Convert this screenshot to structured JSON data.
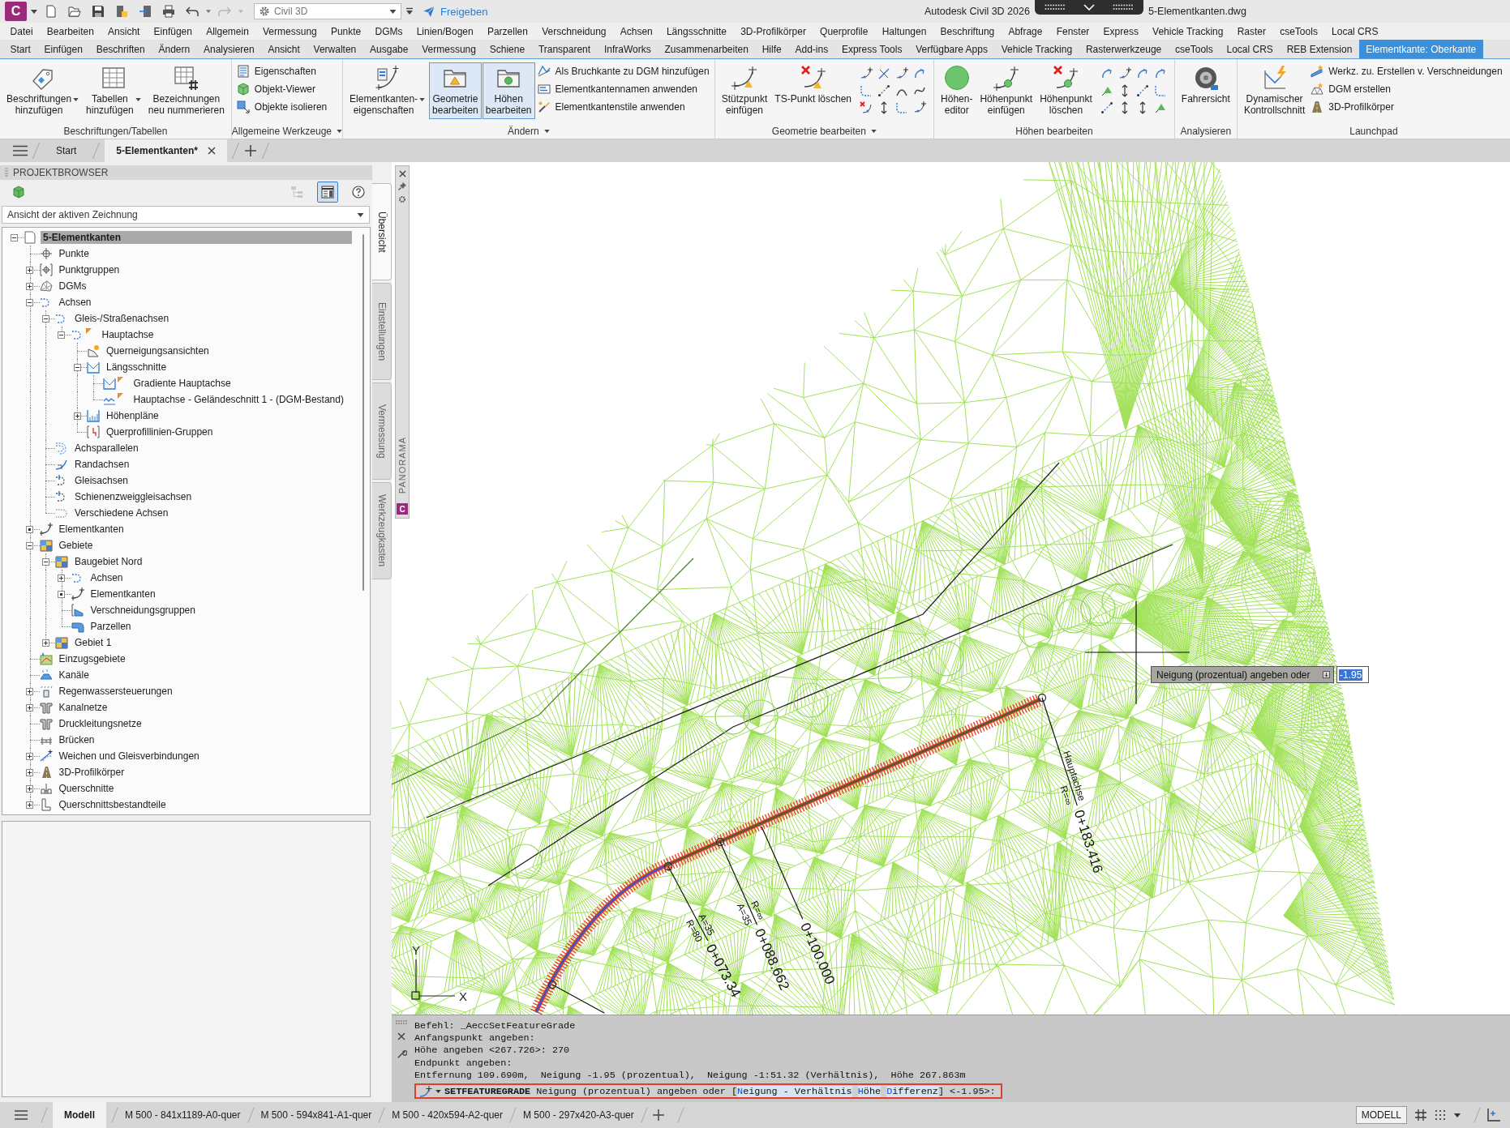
{
  "title_bar": {
    "logo": "C",
    "workspace": "Civil 3D",
    "share": "Freigeben",
    "title": "Autodesk Civil 3D 2026",
    "file": "5-Elementkanten.dwg"
  },
  "menu_bar": [
    "Datei",
    "Bearbeiten",
    "Ansicht",
    "Einfügen",
    "Allgemein",
    "Vermessung",
    "Punkte",
    "DGMs",
    "Linien/Bogen",
    "Parzellen",
    "Verschneidung",
    "Achsen",
    "Längsschnitte",
    "3D-Profilkörper",
    "Querprofile",
    "Haltungen",
    "Beschriftung",
    "Abfrage",
    "Fenster",
    "Express",
    "Vehicle Tracking",
    "Raster",
    "cseTools",
    "Local CRS"
  ],
  "ribbon": {
    "tabs": [
      {
        "label": "Start",
        "selected": false
      },
      {
        "label": "Einfügen",
        "selected": false
      },
      {
        "label": "Beschriften",
        "selected": false
      },
      {
        "label": "Ändern",
        "selected": false
      },
      {
        "label": "Analysieren",
        "selected": false
      },
      {
        "label": "Ansicht",
        "selected": false
      },
      {
        "label": "Verwalten",
        "selected": false
      },
      {
        "label": "Ausgabe",
        "selected": false
      },
      {
        "label": "Vermessung",
        "selected": false
      },
      {
        "label": "Schiene",
        "selected": false
      },
      {
        "label": "Transparent",
        "selected": false
      },
      {
        "label": "InfraWorks",
        "selected": false
      },
      {
        "label": "Zusammenarbeiten",
        "selected": false
      },
      {
        "label": "Hilfe",
        "selected": false
      },
      {
        "label": "Add-ins",
        "selected": false
      },
      {
        "label": "Express Tools",
        "selected": false
      },
      {
        "label": "Verfügbare Apps",
        "selected": false
      },
      {
        "label": "Vehicle Tracking",
        "selected": false
      },
      {
        "label": "Rasterwerkzeuge",
        "selected": false
      },
      {
        "label": "cseTools",
        "selected": false
      },
      {
        "label": "Local CRS",
        "selected": false
      },
      {
        "label": "REB Extension",
        "selected": false
      },
      {
        "label": "Elementkante: Oberkante",
        "selected": true
      }
    ],
    "panels": [
      {
        "title": "Beschriftungen/Tabellen",
        "menu": false,
        "large": [
          {
            "kind": "annotate",
            "label": "Beschriftungen\nhinzufügen",
            "dropdown": true,
            "selected": false
          },
          {
            "kind": "tables",
            "label": "Tabellen\nhinzufügen",
            "dropdown": true,
            "selected": false
          },
          {
            "kind": "renumber",
            "label": "Bezeichnungen\nneu nummerieren",
            "dropdown": false,
            "selected": false
          }
        ]
      },
      {
        "title": "Allgemeine Werkzeuge",
        "menu": true,
        "small": [
          {
            "kind": "properties",
            "label": "Eigenschaften"
          },
          {
            "kind": "viewer",
            "label": "Objekt-Viewer"
          },
          {
            "kind": "isolate",
            "label": "Objekte isolieren"
          }
        ]
      },
      {
        "title": "Ändern",
        "menu": true,
        "large": [
          {
            "kind": "properties",
            "label": "Elementkanten-\neigenschaften",
            "dropdown": true,
            "selected": false
          },
          {
            "kind": "geometry",
            "label": "Geometrie\nbearbeiten",
            "dropdown": false,
            "selected": true
          },
          {
            "kind": "elevations",
            "label": "Höhen\nbearbeiten",
            "dropdown": false,
            "selected": true
          }
        ],
        "small": [
          {
            "kind": "breakline",
            "label": "Als Bruchkante zu DGM hinzufügen"
          },
          {
            "kind": "names",
            "label": "Elementkantennamen anwenden"
          },
          {
            "kind": "styles",
            "label": "Elementkantenstile anwenden"
          }
        ]
      },
      {
        "title": "Geometrie bearbeiten",
        "menu": true,
        "large": [
          {
            "kind": "insert",
            "label": "Stützpunkt\neinfügen",
            "dropdown": false,
            "selected": false
          },
          {
            "kind": "delete",
            "label": "TS-Punkt löschen",
            "dropdown": false,
            "selected": false
          }
        ],
        "grid": [
          {
            "kind": "curvenode"
          },
          {
            "kind": "crossed"
          },
          {
            "kind": "curvenode"
          },
          {
            "kind": "sweep"
          },
          {
            "kind": "corner"
          },
          {
            "kind": "dashed"
          },
          {
            "kind": "arc"
          },
          {
            "kind": "spline"
          },
          {
            "kind": "deletenode"
          },
          {
            "kind": "arrows"
          },
          {
            "kind": "corner"
          },
          {
            "kind": "curvenode"
          }
        ]
      },
      {
        "title": "Höhen bearbeiten",
        "menu": false,
        "large": [
          {
            "kind": "editor",
            "label": "Höhen-\neditor",
            "dropdown": false,
            "selected": false
          },
          {
            "kind": "insertpoint",
            "label": "Höhenpunkt\neinfügen",
            "dropdown": false,
            "selected": false
          },
          {
            "kind": "deletepoint",
            "label": "Höhenpunkt\nlöschen",
            "dropdown": false,
            "selected": false
          }
        ],
        "grid": [
          {
            "kind": "sweep"
          },
          {
            "kind": "curvenode"
          },
          {
            "kind": "sweep"
          },
          {
            "kind": "sweep"
          },
          {
            "kind": "triangle"
          },
          {
            "kind": "arrows"
          },
          {
            "kind": "dashed"
          },
          {
            "kind": "corner"
          },
          {
            "kind": "dashed"
          },
          {
            "kind": "arrows"
          },
          {
            "kind": "arrows"
          },
          {
            "kind": "triangle"
          }
        ]
      },
      {
        "title": "Analysieren",
        "menu": false,
        "large": [
          {
            "kind": "driver",
            "label": "Fahrersicht",
            "dropdown": false,
            "selected": false
          }
        ]
      },
      {
        "title": "Launchpad",
        "menu": false,
        "large": [
          {
            "kind": "section",
            "label": "Dynamischer\nKontrollschnitt",
            "dropdown": false,
            "selected": false
          }
        ],
        "small": [
          {
            "kind": "grading",
            "label": "Werkz. zu. Erstellen v. Verschneidungen"
          },
          {
            "kind": "surface",
            "label": "DGM erstellen"
          },
          {
            "kind": "corridor",
            "label": "3D-Profilkörper"
          }
        ]
      }
    ]
  },
  "document_tabs": [
    {
      "label": "Start",
      "selected": false,
      "closable": false
    },
    {
      "label": "5-Elementkanten*",
      "selected": true,
      "closable": true
    }
  ],
  "project_browser": {
    "title": "PROJEKTBROWSER",
    "toolbar": [
      {
        "kind": "cube",
        "selected": false,
        "disabled": false
      },
      {
        "kind": "hierarchy",
        "selected": false,
        "disabled": true
      },
      {
        "kind": "palette",
        "selected": true,
        "disabled": false
      },
      {
        "kind": "help",
        "selected": false,
        "disabled": false
      }
    ],
    "view": "Ansicht der aktiven Zeichnung",
    "tree": [
      {
        "label": "5-Elementkanten",
        "kind": "drawing",
        "expanded": true,
        "empty": false,
        "selected": true,
        "children": [
          {
            "label": "Punkte",
            "kind": "point",
            "selected": false
          },
          {
            "label": "Punktgruppen",
            "kind": "pointgroup",
            "expanded": false,
            "empty": false,
            "selected": false
          },
          {
            "label": "DGMs",
            "kind": "surface",
            "expanded": false,
            "empty": false,
            "selected": false
          },
          {
            "label": "Achsen",
            "kind": "alignment",
            "expanded": true,
            "empty": false,
            "selected": false,
            "children": [
              {
                "label": "Gleis-/Straßenachsen",
                "kind": "alignment",
                "expanded": true,
                "empty": false,
                "selected": false,
                "children": [
                  {
                    "label": "Hauptachse",
                    "kind": "mainaxis",
                    "expanded": true,
                    "empty": false,
                    "selected": false,
                    "children": [
                      {
                        "label": "Querneigungsansichten",
                        "kind": "superelevation",
                        "selected": false
                      },
                      {
                        "label": "Längsschnitte",
                        "kind": "profile",
                        "expanded": true,
                        "empty": false,
                        "selected": false,
                        "children": [
                          {
                            "label": "Gradiente Hauptachse",
                            "kind": "gradient",
                            "selected": false
                          },
                          {
                            "label": "Hauptachse - Geländeschnitt 1 - (DGM-Bestand)",
                            "kind": "groundprofile",
                            "selected": false
                          }
                        ]
                      },
                      {
                        "label": "Höhenpläne",
                        "kind": "profileview",
                        "expanded": false,
                        "empty": false,
                        "selected": false
                      },
                      {
                        "label": "Querprofillinien-Gruppen",
                        "kind": "sampleline",
                        "selected": false
                      }
                    ]
                  }
                ]
              },
              {
                "label": "Achsparallelen",
                "kind": "offset",
                "selected": false
              },
              {
                "label": "Randachsen",
                "kind": "curb",
                "selected": false
              },
              {
                "label": "Gleisachsen",
                "kind": "rail",
                "selected": false
              },
              {
                "label": "Schienenzweiggleisachsen",
                "kind": "rail",
                "selected": false
              },
              {
                "label": "Verschiedene Achsen",
                "kind": "misc",
                "selected": false
              }
            ]
          },
          {
            "label": "Elementkanten",
            "kind": "featureline",
            "empty": true,
            "selected": false
          },
          {
            "label": "Gebiete",
            "kind": "site",
            "expanded": true,
            "empty": false,
            "selected": false,
            "children": [
              {
                "label": "Baugebiet Nord",
                "kind": "site",
                "expanded": true,
                "empty": false,
                "selected": false,
                "children": [
                  {
                    "label": "Achsen",
                    "kind": "alignment",
                    "expanded": false,
                    "empty": false,
                    "selected": false
                  },
                  {
                    "label": "Elementkanten",
                    "kind": "featureline",
                    "empty": true,
                    "selected": false
                  },
                  {
                    "label": "Verschneidungsgruppen",
                    "kind": "grading",
                    "selected": false
                  },
                  {
                    "label": "Parzellen",
                    "kind": "parcel",
                    "selected": false
                  }
                ]
              },
              {
                "label": "Gebiet 1",
                "kind": "site",
                "expanded": false,
                "empty": false,
                "selected": false
              }
            ]
          },
          {
            "label": "Einzugsgebiete",
            "kind": "catchment",
            "selected": false
          },
          {
            "label": "Kanäle",
            "kind": "channel",
            "selected": false
          },
          {
            "label": "Regenwassersteuerungen",
            "kind": "stormwater",
            "expanded": false,
            "empty": false,
            "selected": false
          },
          {
            "label": "Kanalnetze",
            "kind": "pipes",
            "expanded": false,
            "empty": false,
            "selected": false
          },
          {
            "label": "Druckleitungsnetze",
            "kind": "pipes",
            "selected": false
          },
          {
            "label": "Brücken",
            "kind": "bridge",
            "selected": false
          },
          {
            "label": "Weichen und Gleisverbindungen",
            "kind": "turnout",
            "expanded": false,
            "empty": false,
            "selected": false
          },
          {
            "label": "3D-Profilkörper",
            "kind": "corridor",
            "expanded": false,
            "empty": false,
            "selected": false
          },
          {
            "label": "Querschnitte",
            "kind": "assembly",
            "expanded": false,
            "empty": false,
            "selected": false
          },
          {
            "label": "Querschnittsbestandteile",
            "kind": "subassembly",
            "expanded": false,
            "empty": false,
            "selected": false
          }
        ]
      }
    ]
  },
  "side_tabs": [
    {
      "label": "Übersicht",
      "selected": true
    },
    {
      "label": "Einstellungen",
      "selected": false
    },
    {
      "label": "Vermessung",
      "selected": false
    },
    {
      "label": "Werkzeugkasten",
      "selected": false
    }
  ],
  "panorama": {
    "label": "PANORAMA",
    "logo": "C"
  },
  "canvas": {
    "annotations": [
      {
        "station": "0+183.416",
        "lines": [
          "Hauptachse",
          "R=∞"
        ]
      },
      {
        "station": "0+100.000"
      },
      {
        "station": "0+088.662",
        "lines": [
          "R=∞",
          "A=35"
        ]
      },
      {
        "station": "0+073.34",
        "lines": [
          "A=35",
          "R=80"
        ]
      }
    ],
    "ucs": {
      "x": "X",
      "y": "Y"
    },
    "tooltip": {
      "prompt": "Neigung (prozentual) angeben oder",
      "value": "-1.95"
    }
  },
  "command_line": {
    "history": [
      "Befehl: _AeccSetFeatureGrade",
      "Anfangspunkt angeben:",
      "Höhe angeben <267.726>: 270",
      "Endpunkt angeben:",
      "Entfernung 109.690m,  Neigung -1.95 (prozentual),  Neigung -1:51.32 (Verhältnis),  Höhe 267.863m"
    ],
    "prompt": {
      "command": "SETFEATUREGRADE",
      "text": "Neigung (prozentual) angeben oder [",
      "options": [
        {
          "key": "N",
          "rest": "eigung - Verhältnis"
        },
        {
          "key": "H",
          "rest": "öhe"
        },
        {
          "key": "D",
          "rest": "ifferenz"
        }
      ],
      "suffix": "] <-1.95>:"
    }
  },
  "status_bar": {
    "layouts": [
      {
        "label": "Modell",
        "selected": true
      },
      {
        "label": "M 500 - 841x1189-A0-quer",
        "selected": false
      },
      {
        "label": "M 500 - 594x841-A1-quer",
        "selected": false
      },
      {
        "label": "M 500 - 420x594-A2-quer",
        "selected": false
      },
      {
        "label": "M 500 - 297x420-A3-quer",
        "selected": false
      }
    ],
    "space": "MODELL"
  }
}
